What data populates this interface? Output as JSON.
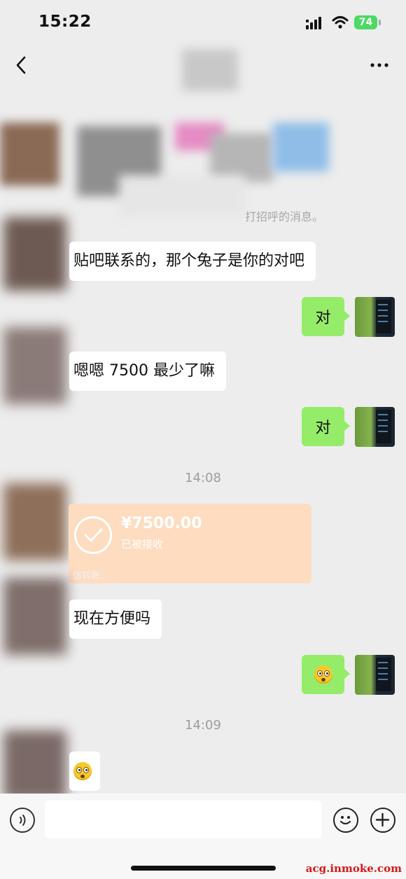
{
  "status_bar": {
    "time": "15:22",
    "battery": "74"
  },
  "chat": {
    "system_note": "打招呼的消息。",
    "messages": [
      {
        "from": "other",
        "text": "贴吧联系的，那个兔子是你的对吧"
      },
      {
        "from": "self",
        "text": "对"
      },
      {
        "from": "other",
        "text": "嗯嗯 7500 最少了嘛"
      },
      {
        "from": "self",
        "text": "对"
      },
      {
        "type": "time",
        "text": "14:08"
      },
      {
        "from": "other",
        "type": "transfer",
        "amount": "¥7500.00",
        "status": "已被接收",
        "footer": "信转账"
      },
      {
        "from": "other",
        "text": "现在方便吗"
      },
      {
        "from": "self",
        "emoji": "astonished-face"
      },
      {
        "type": "time",
        "text": "14:09"
      },
      {
        "from": "other",
        "emoji": "astonished-face"
      }
    ]
  },
  "colors": {
    "bubble_self": "#95ec69",
    "bubble_other": "#ffffff",
    "transfer_bg": "#fddcc0",
    "background": "#ededed"
  },
  "watermark": "acg.inmoke.com"
}
